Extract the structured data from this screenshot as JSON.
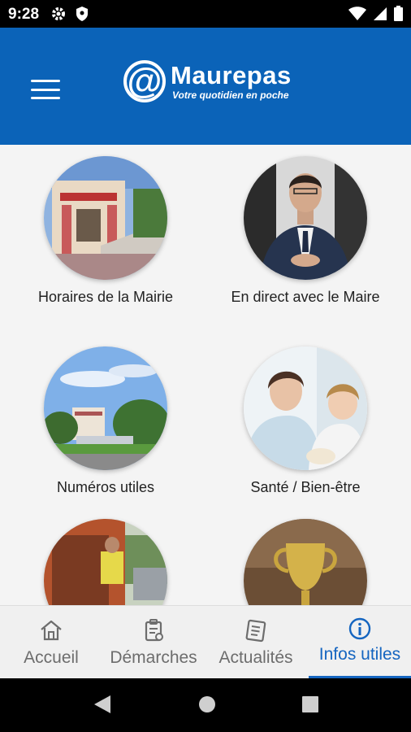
{
  "status_bar": {
    "time": "9:28"
  },
  "app": {
    "title": "Maurepas",
    "tagline": "Votre quotidien en poche",
    "at_symbol": "@"
  },
  "tiles": [
    {
      "label": "Horaires de la Mairie"
    },
    {
      "label": "En direct avec le Maire"
    },
    {
      "label": "Numéros utiles"
    },
    {
      "label": "Santé / Bien-être"
    },
    {
      "label": ""
    },
    {
      "label": ""
    }
  ],
  "bottom_nav": {
    "items": [
      {
        "label": "Accueil",
        "icon": "home-icon"
      },
      {
        "label": "Démarches",
        "icon": "clipboard-icon"
      },
      {
        "label": "Actualités",
        "icon": "newspaper-icon"
      },
      {
        "label": "Infos utiles",
        "icon": "info-icon"
      }
    ],
    "active_index": 3
  },
  "colors": {
    "primary": "#0b63b8",
    "active": "#1565c0",
    "inactive": "#6d6d6d"
  }
}
